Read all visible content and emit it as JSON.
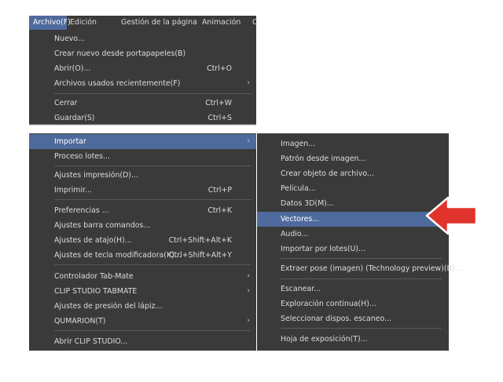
{
  "menubar": {
    "items": [
      "Archivo(F)",
      "Edición",
      "Gestión de la página",
      "Animación",
      "C"
    ]
  },
  "file_menu_top": [
    {
      "label": "Nuevo..."
    },
    {
      "label": "Crear nuevo desde portapapeles(B)"
    },
    {
      "label": "Abrir(O)...",
      "shortcut": "Ctrl+O"
    },
    {
      "label": "Archivos usados recientemente(F)",
      "arrow": "›"
    },
    {
      "label": "Cerrar",
      "shortcut": "Ctrl+W"
    },
    {
      "label": "Guardar(S)",
      "shortcut": "Ctrl+S"
    }
  ],
  "file_menu_bottom": [
    {
      "label": "Importar",
      "arrow": "›"
    },
    {
      "label": "Proceso lotes..."
    },
    {
      "label": "Ajustes impresión(D)..."
    },
    {
      "label": "Imprimir...",
      "shortcut": "Ctrl+P"
    },
    {
      "label": "Preferencias ...",
      "shortcut": "Ctrl+K"
    },
    {
      "label": "Ajustes barra comandos..."
    },
    {
      "label": "Ajustes de atajo(H)...",
      "shortcut": "Ctrl+Shift+Alt+K"
    },
    {
      "label": "Ajustes de tecla modificadora(K)...",
      "shortcut": "Ctrl+Shift+Alt+Y"
    },
    {
      "label": "Controlador Tab-Mate",
      "arrow": "›"
    },
    {
      "label": "CLIP STUDIO TABMATE",
      "arrow": "›"
    },
    {
      "label": "Ajustes de presión del lápiz..."
    },
    {
      "label": "QUMARION(T)",
      "arrow": "›"
    },
    {
      "label": "Abrir CLIP STUDIO..."
    }
  ],
  "import_submenu": [
    {
      "label": "Imagen..."
    },
    {
      "label": "Patrón desde imagen..."
    },
    {
      "label": "Crear objeto de archivo..."
    },
    {
      "label": "Película..."
    },
    {
      "label": "Datos 3D(M)..."
    },
    {
      "label": "Vectores..."
    },
    {
      "label": "Audio..."
    },
    {
      "label": "Importar por lotes(U)..."
    },
    {
      "label": "Extraer pose (imagen) (Technology preview)(B)..."
    },
    {
      "label": "Escanear..."
    },
    {
      "label": "Exploración continua(H)..."
    },
    {
      "label": "Seleccionar dispos. escaneo..."
    },
    {
      "label": "Hoja de exposición(T)..."
    }
  ],
  "colors": {
    "menu_bg": "#3a3a3a",
    "highlight": "#4e6a9c",
    "pointer_arrow": "#e0332b"
  },
  "annotation": {
    "icon": "pointer-arrow-icon"
  }
}
